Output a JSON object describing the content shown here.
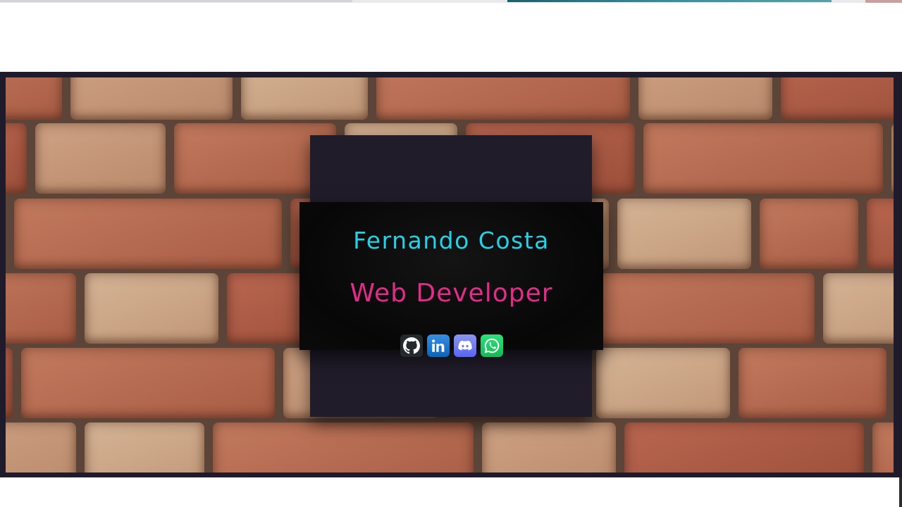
{
  "profile": {
    "name": "Fernando Costa",
    "role": "Web Developer"
  },
  "social_links": [
    {
      "name": "github",
      "icon": "github-icon",
      "color": "#24292e"
    },
    {
      "name": "linkedin",
      "icon": "linkedin-icon",
      "color": "#0a66c2"
    },
    {
      "name": "discord",
      "icon": "discord-icon",
      "color": "#5865f2"
    },
    {
      "name": "whatsapp",
      "icon": "whatsapp-icon",
      "color": "#25d366"
    }
  ],
  "colors": {
    "name_accent": "#22d3e8",
    "role_accent": "#e32c8a",
    "frame": "#1f1b2b",
    "card_band": "#0a0a0a"
  }
}
